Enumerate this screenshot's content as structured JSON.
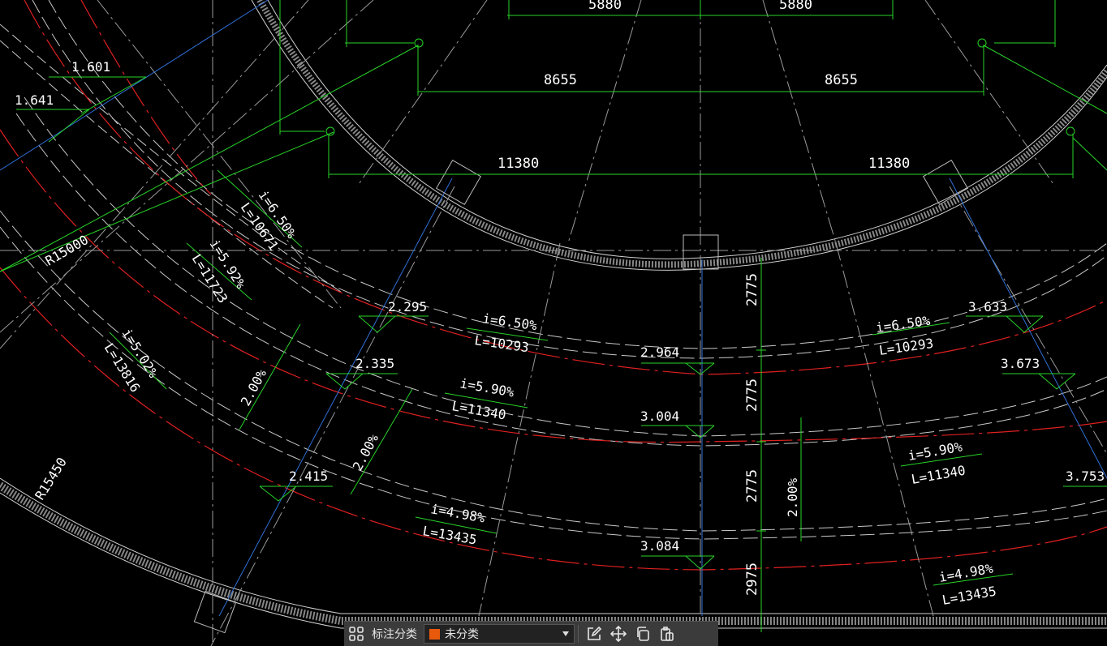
{
  "drawing": {
    "dimensions": {
      "top_left_5880": "5880",
      "top_right_5880": "5880",
      "left_8655": "8655",
      "right_8655": "8655",
      "left_11380": "11380",
      "right_11380": "11380",
      "v1": "2775",
      "v2": "2775",
      "v3": "2775",
      "v4": "2975"
    },
    "radii": {
      "r15000": "R15000",
      "r15450": "R15450"
    },
    "elevations": {
      "e1601": "1.601",
      "e1641": "1.641",
      "e2295": "2.295",
      "e2335": "2.335",
      "e2415": "2.415",
      "e2964": "2.964",
      "e3004": "3.004",
      "e3084": "3.084",
      "e3633": "3.633",
      "e3673": "3.673",
      "e3753": "3.753"
    },
    "slopes": {
      "s1_i": "i=6.50%",
      "s1_l": "L=10671",
      "s2_i": "i=5.92%",
      "s2_l": "L=11723",
      "s3_i": "i=5.02%",
      "s3_l": "L=13816",
      "s4_i": "i=6.50%",
      "s4_l": "L=10293",
      "s5_i": "i=5.90%",
      "s5_l": "L=11340",
      "s6_i": "i=4.98%",
      "s6_l": "L=13435",
      "s7_i": "i=6.50%",
      "s7_l": "L=10293",
      "s8_i": "i=5.90%",
      "s8_l": "L=11340",
      "s9_i": "i=4.98%",
      "s9_l": "L=13435",
      "p1": "2.00%",
      "p2": "2.00%",
      "p3": "2.00%"
    }
  },
  "toolbar": {
    "category_label": "标注分类",
    "selected_category": "未分类",
    "selected_color": "#e8590c",
    "icons": [
      "grid-icon",
      "edit-icon",
      "move-icon",
      "copy-icon",
      "paste-icon"
    ]
  }
}
